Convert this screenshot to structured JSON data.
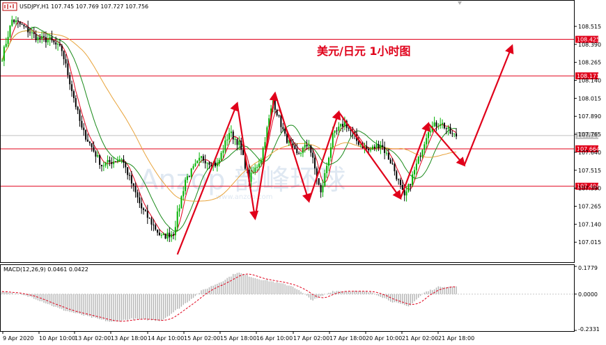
{
  "main_panel": {
    "title": "USDJPY,H1  107.745 107.769 107.727 107.756",
    "annotation": "美元/日元 1小时图",
    "watermark": "Anzop 韵峰环球",
    "watermark_url": "www.anzop.com",
    "colors": {
      "bull": "#00b000",
      "bear": "#000000",
      "ma_fast": "#e0001a",
      "ma_mid": "#1a8a1a",
      "ma_slow": "#e8a33a",
      "level": "#e0001a",
      "arrow": "#e0001a",
      "current": "#c0c0c0"
    }
  },
  "macd_panel": {
    "title": "MACD(12,26,9) 0.0461 0.0422",
    "top_label": "0.1779",
    "zero_label": "0.0000",
    "bottom_label": "-0.2331"
  },
  "chart_data": [
    {
      "type": "candlestick",
      "symbol": "USDJPY",
      "timeframe": "H1",
      "ylim": [
        106.9,
        108.65
      ],
      "y_ticks": [
        "108.515",
        "108.390",
        "108.265",
        "108.140",
        "108.015",
        "107.890",
        "107.765",
        "107.640",
        "107.515",
        "107.390",
        "107.265",
        "107.140",
        "107.015"
      ],
      "x_ticks": [
        "9 Apr 2020",
        "10 Apr 10:00",
        "13 Apr 02:00",
        "13 Apr 18:00",
        "14 Apr 10:00",
        "15 Apr 02:00",
        "15 Apr 18:00",
        "16 Apr 10:00",
        "17 Apr 02:00",
        "17 Apr 18:00",
        "20 Apr 10:00",
        "21 Apr 02:00",
        "21 Apr 18:00"
      ],
      "price_tags": [
        {
          "label": "108.425",
          "value": 108.425,
          "kind": "level"
        },
        {
          "label": "108.171",
          "value": 108.171,
          "kind": "level"
        },
        {
          "label": "107.756",
          "value": 107.756,
          "kind": "current"
        },
        {
          "label": "107.664",
          "value": 107.664,
          "kind": "level"
        },
        {
          "label": "107.404",
          "value": 107.404,
          "kind": "level"
        }
      ],
      "anchors": [
        {
          "i": 0,
          "p": 108.3
        },
        {
          "i": 5,
          "p": 108.56
        },
        {
          "i": 10,
          "p": 108.52
        },
        {
          "i": 18,
          "p": 108.43
        },
        {
          "i": 24,
          "p": 108.42
        },
        {
          "i": 30,
          "p": 108.35
        },
        {
          "i": 40,
          "p": 107.8
        },
        {
          "i": 50,
          "p": 107.55
        },
        {
          "i": 60,
          "p": 107.6
        },
        {
          "i": 70,
          "p": 107.25
        },
        {
          "i": 80,
          "p": 107.05
        },
        {
          "i": 86,
          "p": 107.08
        },
        {
          "i": 92,
          "p": 107.45
        },
        {
          "i": 100,
          "p": 107.6
        },
        {
          "i": 108,
          "p": 107.55
        },
        {
          "i": 114,
          "p": 107.78
        },
        {
          "i": 119,
          "p": 107.7
        },
        {
          "i": 124,
          "p": 107.45
        },
        {
          "i": 130,
          "p": 107.6
        },
        {
          "i": 136,
          "p": 108.0
        },
        {
          "i": 142,
          "p": 107.75
        },
        {
          "i": 148,
          "p": 107.62
        },
        {
          "i": 154,
          "p": 107.7
        },
        {
          "i": 160,
          "p": 107.35
        },
        {
          "i": 166,
          "p": 107.75
        },
        {
          "i": 172,
          "p": 107.85
        },
        {
          "i": 178,
          "p": 107.72
        },
        {
          "i": 184,
          "p": 107.65
        },
        {
          "i": 190,
          "p": 107.7
        },
        {
          "i": 196,
          "p": 107.55
        },
        {
          "i": 202,
          "p": 107.32
        },
        {
          "i": 208,
          "p": 107.55
        },
        {
          "i": 214,
          "p": 107.8
        },
        {
          "i": 220,
          "p": 107.85
        },
        {
          "i": 226,
          "p": 107.76
        }
      ],
      "pattern_path": [
        {
          "i": 88,
          "p": 106.93
        },
        {
          "i": 118,
          "p": 107.98
        },
        {
          "i": 127,
          "p": 107.18
        },
        {
          "i": 137,
          "p": 108.05
        },
        {
          "i": 154,
          "p": 107.3
        },
        {
          "i": 169,
          "p": 107.92
        },
        {
          "i": 200,
          "p": 107.32
        },
        {
          "i": 214,
          "p": 107.84
        },
        {
          "i": 232,
          "p": 107.55
        },
        {
          "i": 256,
          "p": 108.38
        }
      ]
    },
    {
      "type": "histogram",
      "name": "MACD(12,26,9)",
      "ylim": [
        -0.2331,
        0.1779
      ],
      "x_ticks": [
        "9 Apr 2020",
        "10 Apr 10:00",
        "13 Apr 02:00",
        "13 Apr 18:00",
        "14 Apr 10:00",
        "15 Apr 02:00",
        "15 Apr 18:00",
        "16 Apr 10:00",
        "17 Apr 02:00",
        "17 Apr 18:00",
        "20 Apr 10:00",
        "21 Apr 02:00",
        "21 Apr 18:00"
      ],
      "main_value": 0.0461,
      "signal_value": 0.0422,
      "anchors": [
        {
          "i": 0,
          "v": 0.02
        },
        {
          "i": 15,
          "v": -0.02
        },
        {
          "i": 30,
          "v": -0.1
        },
        {
          "i": 45,
          "v": -0.15
        },
        {
          "i": 55,
          "v": -0.18
        },
        {
          "i": 65,
          "v": -0.16
        },
        {
          "i": 80,
          "v": -0.17
        },
        {
          "i": 90,
          "v": -0.08
        },
        {
          "i": 100,
          "v": 0.02
        },
        {
          "i": 110,
          "v": 0.08
        },
        {
          "i": 118,
          "v": 0.14
        },
        {
          "i": 128,
          "v": 0.1
        },
        {
          "i": 136,
          "v": 0.08
        },
        {
          "i": 146,
          "v": 0.05
        },
        {
          "i": 156,
          "v": -0.04
        },
        {
          "i": 166,
          "v": 0.02
        },
        {
          "i": 176,
          "v": 0.02
        },
        {
          "i": 186,
          "v": 0.01
        },
        {
          "i": 196,
          "v": -0.05
        },
        {
          "i": 204,
          "v": -0.08
        },
        {
          "i": 212,
          "v": 0.01
        },
        {
          "i": 220,
          "v": 0.05
        },
        {
          "i": 226,
          "v": 0.046
        }
      ]
    }
  ]
}
